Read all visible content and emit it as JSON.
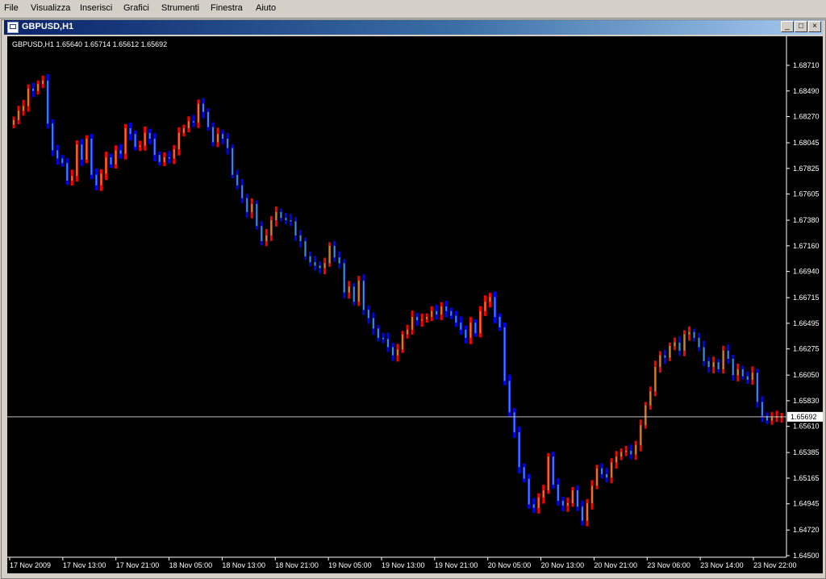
{
  "menu": [
    "File",
    "Visualizza",
    "Inserisci",
    "Grafici",
    "Strumenti",
    "Finestra",
    "Aiuto"
  ],
  "window": {
    "title": "GBPUSD,H1",
    "buttons": [
      "_",
      "□",
      "×"
    ]
  },
  "info": "GBPUSD,H1  1.65640 1.65714 1.65612 1.65692",
  "colors": {
    "background": "#000000",
    "bull": "#ff0000",
    "bear": "#0000ff",
    "body": "#c8822a",
    "bodyBear": "#3c8cd8",
    "axis": "#ffffff",
    "priceLine": "#c0c0c0"
  },
  "chart_data": {
    "type": "candlestick",
    "symbol": "GBPUSD",
    "timeframe": "H1",
    "current_price": "1.65692",
    "y_ticks": [
      "1.68710",
      "1.68490",
      "1.68270",
      "1.68045",
      "1.67825",
      "1.67605",
      "1.67380",
      "1.67160",
      "1.66940",
      "1.66715",
      "1.66495",
      "1.66275",
      "1.66050",
      "1.65830",
      "1.65610",
      "1.65385",
      "1.65165",
      "1.64945",
      "1.64720",
      "1.64500"
    ],
    "ylim": [
      1.645,
      1.6871
    ],
    "x_ticks": [
      "17 Nov 2009",
      "17 Nov 13:00",
      "17 Nov 21:00",
      "18 Nov 05:00",
      "18 Nov 13:00",
      "18 Nov 21:00",
      "19 Nov 05:00",
      "19 Nov 13:00",
      "19 Nov 21:00",
      "20 Nov 05:00",
      "20 Nov 13:00",
      "20 Nov 21:00",
      "23 Nov 06:00",
      "23 Nov 14:00",
      "23 Nov 22:00"
    ],
    "closes": [
      1.6824,
      1.6832,
      1.6836,
      1.6851,
      1.6849,
      1.6855,
      1.6858,
      1.6821,
      1.6798,
      1.6791,
      1.6787,
      1.6772,
      1.6776,
      1.6803,
      1.679,
      1.6808,
      1.6777,
      1.6768,
      1.6778,
      1.6792,
      1.6786,
      1.6798,
      1.6795,
      1.6817,
      1.6812,
      1.6801,
      1.6802,
      1.6813,
      1.6808,
      1.6794,
      1.6788,
      1.6792,
      1.6791,
      1.6799,
      1.6813,
      1.6817,
      1.6823,
      1.6822,
      1.6838,
      1.6831,
      1.6818,
      1.6805,
      1.6812,
      1.6808,
      1.68,
      1.6777,
      1.6768,
      1.6757,
      1.6745,
      1.6752,
      1.6733,
      1.672,
      1.6725,
      1.6738,
      1.6745,
      1.674,
      1.6738,
      1.6737,
      1.6725,
      1.672,
      1.6707,
      1.6702,
      1.6699,
      1.6697,
      1.6701,
      1.6716,
      1.6706,
      1.6701,
      1.6676,
      1.6681,
      1.6668,
      1.6686,
      1.6661,
      1.6654,
      1.6645,
      1.6637,
      1.6636,
      1.6629,
      1.6622,
      1.6627,
      1.664,
      1.6644,
      1.6655,
      1.6652,
      1.6653,
      1.6655,
      1.666,
      1.6657,
      1.6664,
      1.666,
      1.6656,
      1.665,
      1.6644,
      1.6637,
      1.665,
      1.6641,
      1.666,
      1.6668,
      1.6672,
      1.6655,
      1.6646,
      1.66,
      1.6573,
      1.6556,
      1.6526,
      1.6516,
      1.6494,
      1.6491,
      1.65,
      1.6506,
      1.6535,
      1.6511,
      1.6497,
      1.6493,
      1.6495,
      1.6506,
      1.6492,
      1.648,
      1.6495,
      1.651,
      1.6525,
      1.652,
      1.6517,
      1.653,
      1.6535,
      1.6539,
      1.654,
      1.6537,
      1.6545,
      1.6562,
      1.6579,
      1.6591,
      1.6612,
      1.6622,
      1.662,
      1.663,
      1.6633,
      1.6626,
      1.664,
      1.6642,
      1.6637,
      1.6629,
      1.6617,
      1.6612,
      1.6616,
      1.661,
      1.6626,
      1.6619,
      1.6605,
      1.661,
      1.6604,
      1.6601,
      1.6607,
      1.6582,
      1.657,
      1.6566,
      1.6569,
      1.6569,
      1.6569
    ]
  }
}
